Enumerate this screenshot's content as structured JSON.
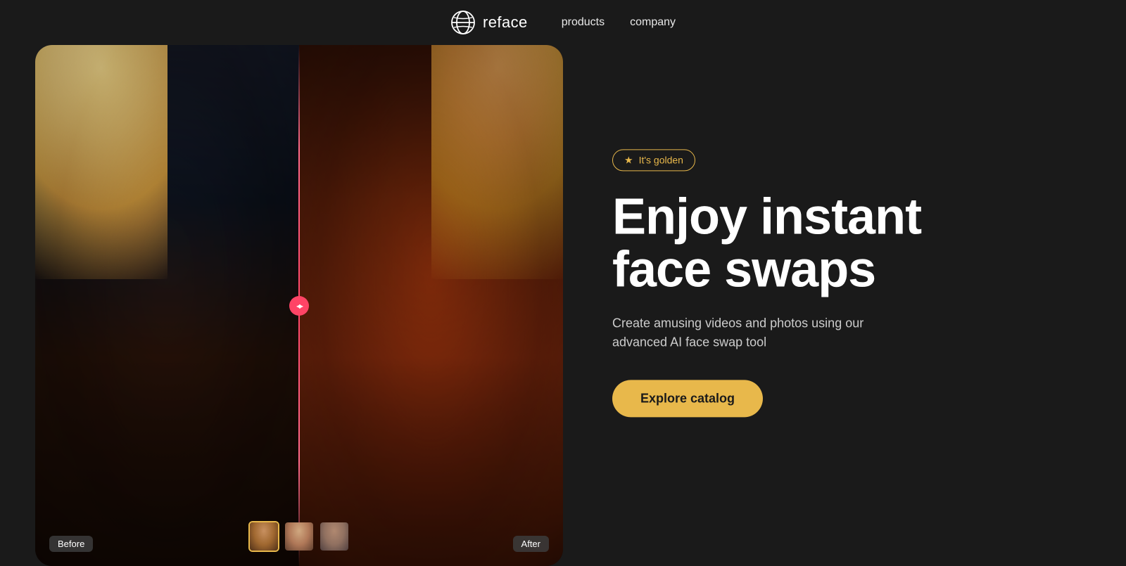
{
  "nav": {
    "logo_text": "reface",
    "links": [
      {
        "label": "products",
        "id": "products"
      },
      {
        "label": "company",
        "id": "company"
      }
    ]
  },
  "hero": {
    "badge_text": "It's golden",
    "title_line1": "Enjoy instant",
    "title_line2": "face swaps",
    "subtitle": "Create amusing videos and photos using our advanced AI face swap tool",
    "cta_label": "Explore catalog",
    "label_before": "Before",
    "label_after": "After"
  }
}
